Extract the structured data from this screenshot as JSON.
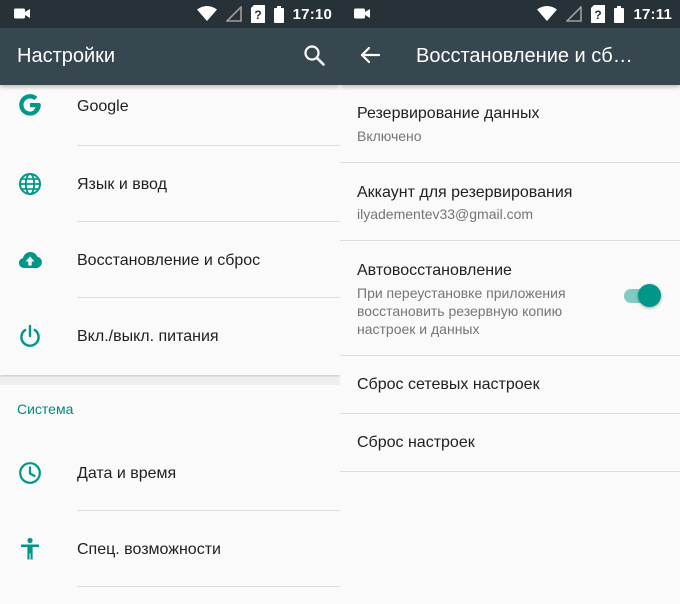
{
  "left": {
    "status": {
      "time": "17:10"
    },
    "toolbar": {
      "title": "Настройки",
      "search_icon": "search-icon"
    },
    "items": [
      {
        "label": "Google",
        "icon": "google-icon"
      },
      {
        "label": "Язык и ввод",
        "icon": "globe-icon"
      },
      {
        "label": "Восстановление и сброс",
        "icon": "cloud-upload-icon"
      },
      {
        "label": "Вкл./выкл. питания",
        "icon": "power-icon"
      }
    ],
    "section": {
      "title": "Система"
    },
    "system_items": [
      {
        "label": "Дата и время",
        "icon": "clock-icon"
      },
      {
        "label": "Спец. возможности",
        "icon": "accessibility-icon"
      }
    ]
  },
  "right": {
    "status": {
      "time": "17:11"
    },
    "toolbar": {
      "title": "Восстановление и сб…",
      "back_icon": "arrow-back-icon"
    },
    "prefs": [
      {
        "title": "Резервирование данных",
        "summary": "Включено"
      },
      {
        "title": "Аккаунт для резервирования",
        "summary": "ilyadementev33@gmail.com"
      },
      {
        "title": "Автовосстановление",
        "summary_lines": [
          "При переустановке приложения",
          "восстановить резервную копию",
          "настроек и данных"
        ],
        "toggle_on": true
      },
      {
        "title": "Сброс сетевых настроек"
      },
      {
        "title": "Сброс настроек"
      }
    ]
  },
  "colors": {
    "accent": "#009688",
    "toolbar": "#37474f",
    "statusbar": "#263238",
    "section": "#00897b"
  }
}
